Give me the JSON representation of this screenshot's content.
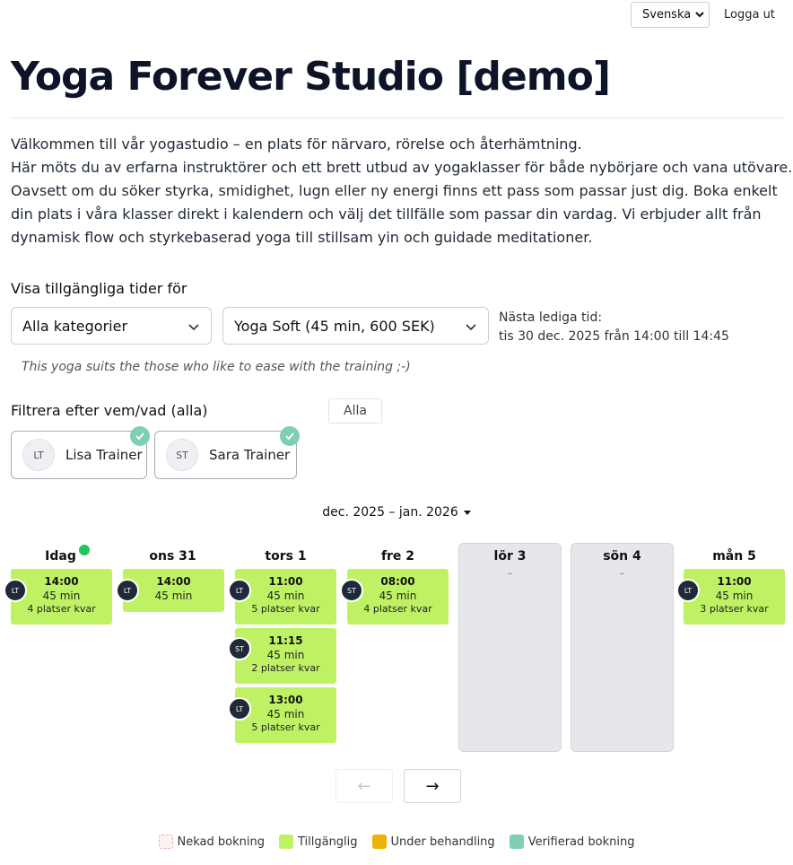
{
  "header": {
    "language": "Svenska",
    "logout": "Logga ut"
  },
  "title": "Yoga Forever Studio [demo]",
  "intro": {
    "lines": [
      "Välkommen till vår yogastudio – en plats för närvaro, rörelse och återhämtning.",
      "Här möts du av erfarna instruktörer och ett brett utbud av yogaklasser för både nybörjare och vana utövare.",
      "Oavsett om du söker styrka, smidighet, lugn eller ny energi finns ett pass som passar just dig. Boka enkelt",
      "din plats i våra klasser direkt i kalendern och välj det tillfälle som passar din vardag. Vi erbjuder allt från",
      "dynamisk flow och styrkebaserad yoga till stillsam yin och guidade meditationer."
    ]
  },
  "booking": {
    "show_label": "Visa tillgängliga tider för",
    "category": "Alla kategorier",
    "service": "Yoga Soft (45 min, 600 SEK)",
    "next_free_label": "Nästa lediga tid:",
    "next_free_value": "tis 30 dec. 2025 från 14:00 till 14:45",
    "service_description": "This yoga suits the those who like to ease with the training ;-)"
  },
  "filter": {
    "label": "Filtrera efter vem/vad (alla)",
    "all_button": "Alla",
    "trainers": [
      {
        "initials": "LT",
        "name": "Lisa Trainer"
      },
      {
        "initials": "ST",
        "name": "Sara Trainer"
      }
    ]
  },
  "calendar": {
    "range": "dec. 2025 – jan. 2026",
    "days": [
      {
        "label": "Idag"
      },
      {
        "label": "ons 31"
      },
      {
        "label": "tors 1"
      },
      {
        "label": "fre 2"
      },
      {
        "label": "lör 3",
        "empty": "–"
      },
      {
        "label": "sön 4",
        "empty": "–"
      },
      {
        "label": "mån 5"
      }
    ],
    "slots": {
      "s0": {
        "time": "14:00",
        "duration": "45 min",
        "places": "4 platser kvar",
        "trainer": "LT"
      },
      "s1": {
        "time": "14:00",
        "duration": "45 min",
        "trainer": "LT"
      },
      "s2": {
        "time": "11:00",
        "duration": "45 min",
        "places": "5 platser kvar",
        "trainer": "LT"
      },
      "s3": {
        "time": "11:15",
        "duration": "45 min",
        "places": "2 platser kvar",
        "trainer": "ST"
      },
      "s4": {
        "time": "13:00",
        "duration": "45 min",
        "places": "5 platser kvar",
        "trainer": "LT"
      },
      "s5": {
        "time": "08:00",
        "duration": "45 min",
        "places": "4 platser kvar",
        "trainer": "ST"
      },
      "s6": {
        "time": "11:00",
        "duration": "45 min",
        "places": "3 platser kvar",
        "trainer": "LT"
      }
    },
    "prev": "←",
    "next": "→"
  },
  "legend": [
    {
      "label": "Nekad bokning",
      "color": "#fdf2f2"
    },
    {
      "label": "Tillgänglig",
      "color": "#bef264"
    },
    {
      "label": "Under behandling",
      "color": "#eab308"
    },
    {
      "label": "Verifierad bokning",
      "color": "#7fcfb3"
    }
  ],
  "colors": {
    "available": "#bef264",
    "today_dot": "#22c55e",
    "check": "#7fcfb3",
    "badge": "#1f2937"
  }
}
